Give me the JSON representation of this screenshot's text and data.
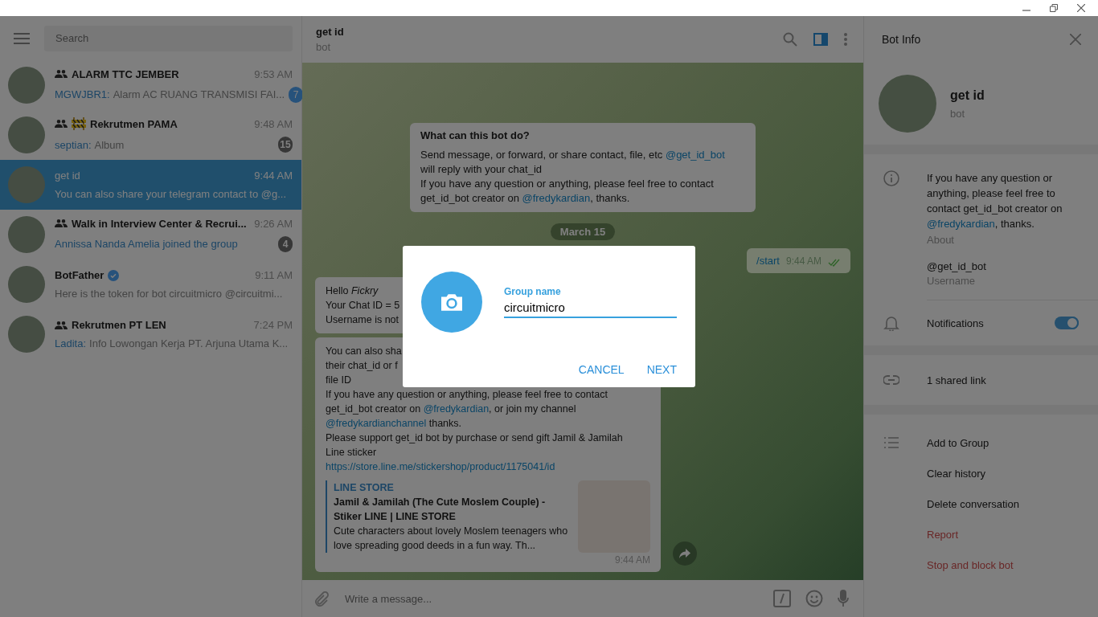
{
  "sidebar": {
    "search": {
      "placeholder": "Search"
    },
    "chats": [
      {
        "name": "ALARM TTC JEMBER",
        "group": true,
        "verified": false,
        "time": "9:53 AM",
        "sender": "MGWJBR1:",
        "preview": "Alarm AC RUANG TRANSMISI FAI...",
        "service": false,
        "sign": false,
        "unread": "7",
        "muted": false,
        "selected": false
      },
      {
        "name": "Rekrutmen PAMA",
        "group": true,
        "verified": false,
        "sign": true,
        "time": "9:48 AM",
        "sender": "septian:",
        "preview": "Album",
        "service": false,
        "unread": "15",
        "muted": true,
        "selected": false
      },
      {
        "name": "get id",
        "group": false,
        "verified": false,
        "time": "9:44 AM",
        "preview": "You can also share your telegram contact to @g...",
        "service": false,
        "sign": false,
        "selected": true
      },
      {
        "name": "Walk in Interview Center & Recrui...",
        "group": true,
        "verified": false,
        "time": "9:26 AM",
        "preview": "Annissa Nanda Amelia joined the group",
        "service": true,
        "sign": false,
        "unread": "4",
        "muted": true,
        "selected": false
      },
      {
        "name": "BotFather",
        "group": false,
        "verified": true,
        "time": "9:11 AM",
        "preview": "Here is the token for bot circuitmicro @circuitmi...",
        "service": false,
        "sign": false,
        "selected": false
      },
      {
        "name": "Rekrutmen PT LEN",
        "group": true,
        "verified": false,
        "time": "7:24 PM",
        "sender": "Ladita:",
        "preview": "Info Lowongan Kerja  PT. Arjuna Utama K...",
        "service": false,
        "sign": false,
        "selected": false
      }
    ]
  },
  "chat": {
    "title": "get id",
    "subtitle": "bot",
    "info_panel_open": true,
    "messages": [
      {
        "kind": "intro",
        "title": "What can this bot do?",
        "lines": [
          [
            "Send message, or forward, or share contact, file, etc ",
            {
              "link": "@get_id_bot"
            }
          ],
          [
            "will reply with your chat_id"
          ],
          [
            "If you have any question or anything, please feel free to contact"
          ],
          [
            "get_id_bot creator on ",
            {
              "link": "@fredykardian"
            },
            ", thanks."
          ]
        ]
      },
      {
        "kind": "date",
        "text": "March 15"
      },
      {
        "kind": "outgoing",
        "text": "/start",
        "time": "9:44 AM",
        "read": true
      },
      {
        "kind": "incoming",
        "lines": [
          [
            "Hello *Fickry*"
          ],
          [
            "Your Chat ID = 5"
          ],
          [
            "Username is not"
          ]
        ]
      },
      {
        "kind": "incoming",
        "forward_button": true,
        "lines": [
          [
            "You can also sha"
          ],
          [
            "their chat_id or f"
          ],
          [
            "file ID"
          ],
          [
            "If you have any question or anything, please feel free to contact"
          ],
          [
            "get_id_bot creator on ",
            {
              "link": "@fredykardian"
            },
            ", or join my channel"
          ],
          [
            {
              "link": "@fredykardianchannel"
            },
            " thanks."
          ],
          [
            "Please support get_id bot by purchase or send gift Jamil & Jamilah"
          ],
          [
            "Line sticker"
          ],
          [
            {
              "link": "https://store.line.me/stickershop/product/1175041/id"
            }
          ]
        ],
        "preview": {
          "site": "LINE STORE",
          "title": "Jamil & Jamilah (The Cute Moslem Couple) - Stiker LINE | LINE STORE",
          "description": "Cute characters about lovely Moslem teenagers who love spreading good deeds in a fun way. Th..."
        },
        "time": "9:44 AM"
      }
    ],
    "composer": {
      "placeholder": "Write a message..."
    }
  },
  "info": {
    "title": "Bot Info",
    "name": "get id",
    "status": "bot",
    "about": [
      "If you have any question or anything, please feel free to contact get_id_bot creator on ",
      {
        "link": "@fredykardian"
      },
      ", thanks."
    ],
    "about_label": "About",
    "username": "@get_id_bot",
    "username_label": "Username",
    "notifications": {
      "label": "Notifications",
      "on": true
    },
    "shared": "1 shared link",
    "actions": [
      {
        "label": "Add to Group",
        "kind": "normal"
      },
      {
        "label": "Clear history",
        "kind": "normal"
      },
      {
        "label": "Delete conversation",
        "kind": "normal"
      },
      {
        "label": "Report",
        "kind": "danger"
      },
      {
        "label": "Stop and block bot",
        "kind": "danger"
      }
    ]
  },
  "dialog": {
    "label": "Group name",
    "value": "circuitmicro",
    "buttons": [
      "CANCEL",
      "NEXT"
    ]
  }
}
